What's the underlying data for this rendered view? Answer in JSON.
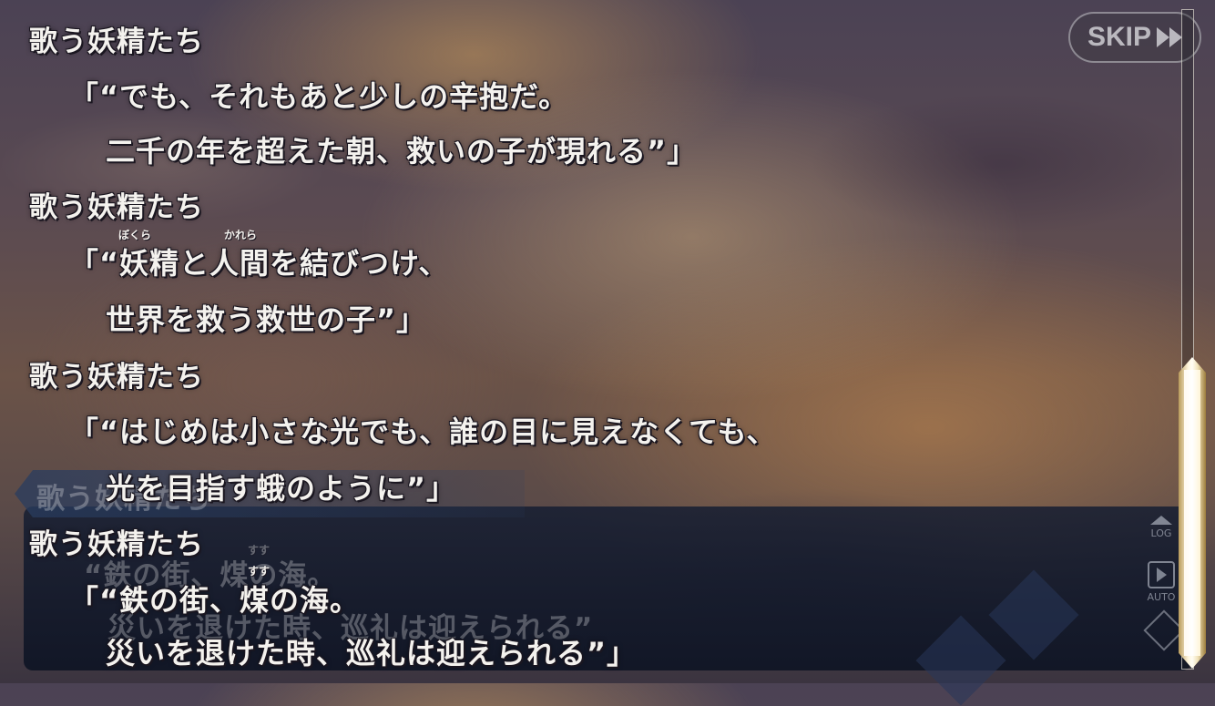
{
  "skip_button": {
    "label": "SKIP"
  },
  "log": [
    {
      "speaker": "歌う妖精たち",
      "lines": [
        "「“でも、それもあと少しの辛抱だ。",
        "二千の年を超えた朝、救いの子が現れる”」"
      ]
    },
    {
      "speaker": "歌う妖精たち",
      "lines": [
        "「“妖精と人間を結びつけ、",
        "世界を救う救世の子”」"
      ],
      "ruby": [
        "ぼくら",
        "かれら"
      ]
    },
    {
      "speaker": "歌う妖精たち",
      "lines": [
        "「“はじめは小さな光でも、誰の目に見えなくても、",
        "光を目指す蛾のように”」"
      ]
    },
    {
      "speaker": "歌う妖精たち",
      "lines": [
        "「“鉄の街、煤の海。",
        "災いを退けた時、巡礼は迎えられる”」"
      ],
      "ruby": [
        "すす"
      ]
    }
  ],
  "background_dialogue": {
    "speaker": "歌う妖精たち",
    "line1": "“鉄の街、煤の海。",
    "line2": "災いを退けた時、巡礼は迎えられる”",
    "ruby": "すす"
  },
  "side_controls": {
    "log_label": "LOG",
    "auto_label": "AUTO"
  }
}
